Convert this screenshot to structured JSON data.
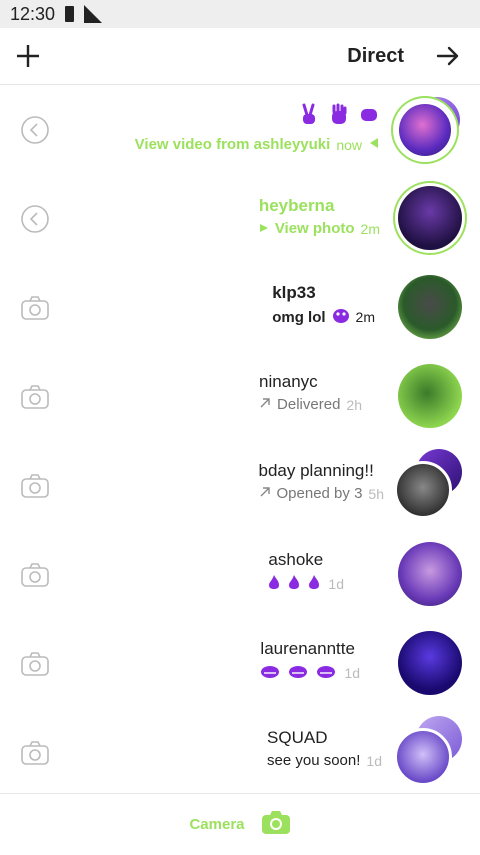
{
  "status": {
    "time": "12:30"
  },
  "header": {
    "title": "Direct"
  },
  "colors": {
    "accent_green": "#9be15d",
    "accent_purple": "#8a2be2"
  },
  "rows": [
    {
      "title": "",
      "sub": "View video from ashleyyuki",
      "time": "now",
      "left_icon": "back-arrow-icon"
    },
    {
      "title": "heyberna",
      "sub": "View photo",
      "time": "2m",
      "left_icon": "back-arrow-icon"
    },
    {
      "title": "klp33",
      "sub": "omg lol",
      "time": "2m",
      "left_icon": "camera-icon"
    },
    {
      "title": "ninanyc",
      "sub": "Delivered",
      "time": "2h",
      "left_icon": "camera-icon"
    },
    {
      "title": "bday planning!!",
      "sub": "Opened by 3",
      "time": "5h",
      "left_icon": "camera-icon"
    },
    {
      "title": "ashoke",
      "sub": "",
      "time": "1d",
      "left_icon": "camera-icon"
    },
    {
      "title": "laurenanntte",
      "sub": "",
      "time": "1d",
      "left_icon": "camera-icon"
    },
    {
      "title": "SQUAD",
      "sub": "see you soon!",
      "time": "1d",
      "left_icon": "camera-icon"
    }
  ],
  "bottom": {
    "camera_label": "Camera"
  }
}
